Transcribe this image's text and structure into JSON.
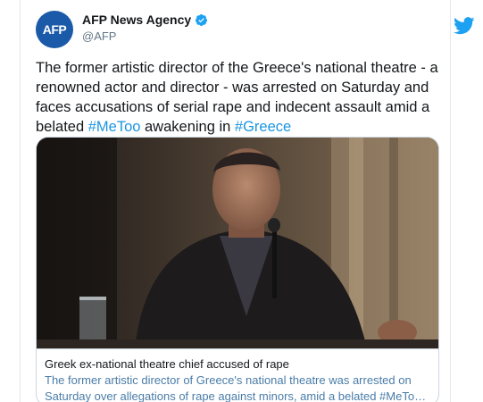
{
  "tweet": {
    "display_name": "AFP News Agency",
    "handle": "@AFP",
    "avatar_text": "AFP",
    "verified": true,
    "body_prefix": "The former artistic director of the Greece's national theatre - a renowned actor and director - was arrested on Saturday and faces accusations of serial rape and indecent assault amid a belated ",
    "hashtag_1": "#MeToo",
    "body_middle": " awakening in ",
    "hashtag_2": "#Greece"
  },
  "card": {
    "title": "Greek ex-national theatre chief accused of rape",
    "description_line1": "The former artistic director of Greece's national theatre was arrested on",
    "description_line2": "Saturday over allegations of rape against minors, amid a belated #MeTo…"
  },
  "colors": {
    "brand_blue": "#1DA1F2",
    "hashtag_blue": "#1b95e0",
    "avatar_bg": "#1a5aa8"
  }
}
